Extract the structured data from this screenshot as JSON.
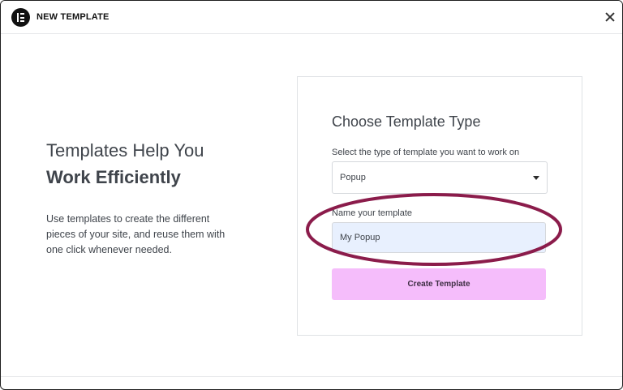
{
  "header": {
    "title": "NEW TEMPLATE"
  },
  "intro": {
    "heading_line1": "Templates Help You",
    "heading_line2": "Work Efficiently",
    "description": "Use templates to create the different pieces of your site, and reuse them with one click whenever needed."
  },
  "form": {
    "title": "Choose Template Type",
    "type_label": "Select the type of template you want to work on",
    "type_selected": "Popup",
    "name_label": "Name your template",
    "name_value": "My Popup",
    "submit_label": "Create Template"
  },
  "icons": {
    "logo": "elementor-logo-icon",
    "close": "close-icon",
    "dropdown": "caret-down-icon"
  },
  "colors": {
    "accent_button": "#f5bdfb",
    "input_fill": "#e8f0fe",
    "highlight_ring": "#8b1c4b"
  }
}
